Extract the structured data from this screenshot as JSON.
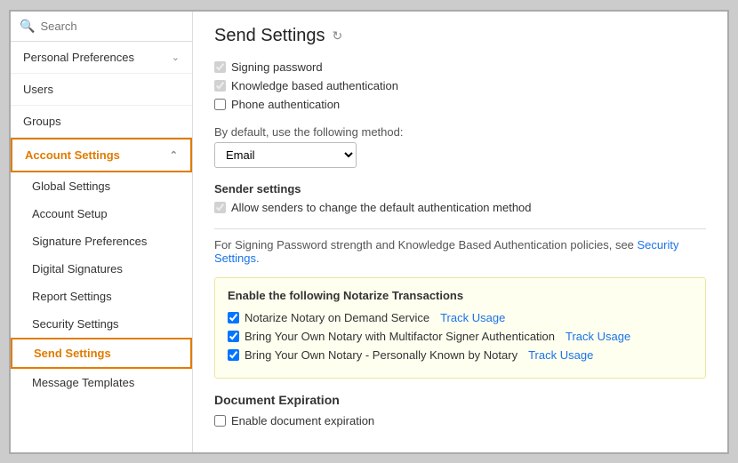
{
  "sidebar": {
    "search_placeholder": "Search",
    "nav_items": [
      {
        "id": "personal-preferences",
        "label": "Personal Preferences",
        "hasChevron": true,
        "expanded": false,
        "active": false
      },
      {
        "id": "users",
        "label": "Users",
        "hasChevron": false,
        "expanded": false,
        "active": false
      },
      {
        "id": "groups",
        "label": "Groups",
        "hasChevron": false,
        "expanded": false,
        "active": false
      },
      {
        "id": "account-settings",
        "label": "Account Settings",
        "hasChevron": true,
        "expanded": true,
        "active": true
      }
    ],
    "sub_items": [
      {
        "id": "global-settings",
        "label": "Global Settings",
        "active": false
      },
      {
        "id": "account-setup",
        "label": "Account Setup",
        "active": false
      },
      {
        "id": "signature-preferences",
        "label": "Signature Preferences",
        "active": false
      },
      {
        "id": "digital-signatures",
        "label": "Digital Signatures",
        "active": false
      },
      {
        "id": "report-settings",
        "label": "Report Settings",
        "active": false
      },
      {
        "id": "security-settings",
        "label": "Security Settings",
        "active": false
      },
      {
        "id": "send-settings",
        "label": "Send Settings",
        "active": true
      },
      {
        "id": "message-templates",
        "label": "Message Templates",
        "active": false
      }
    ]
  },
  "main": {
    "title": "Send Settings",
    "checkboxes": {
      "signing_password": {
        "label": "Signing password",
        "checked": true
      },
      "knowledge_based": {
        "label": "Knowledge based authentication",
        "checked": true
      },
      "phone_auth": {
        "label": "Phone authentication",
        "checked": false
      }
    },
    "default_method_label": "By default, use the following method:",
    "default_method_options": [
      "Email"
    ],
    "default_method_value": "Email",
    "sender_settings_label": "Sender settings",
    "allow_senders_label": "Allow senders to change the default authentication method",
    "security_note": "For Signing Password strength and Knowledge Based Authentication policies, see ",
    "security_link_label": "Security Settings.",
    "notarize_section": {
      "title": "Enable the following Notarize Transactions",
      "items": [
        {
          "label": "Notarize Notary on Demand Service",
          "checked": true,
          "track_label": "Track Usage"
        },
        {
          "label": "Bring Your Own Notary with Multifactor Signer Authentication",
          "checked": true,
          "track_label": "Track Usage"
        },
        {
          "label": "Bring Your Own Notary - Personally Known by Notary",
          "checked": true,
          "track_label": "Track Usage"
        }
      ]
    },
    "doc_expiration": {
      "title": "Document Expiration",
      "enable_label": "Enable document expiration",
      "checked": false
    }
  },
  "icons": {
    "search": "🔍",
    "refresh": "↻",
    "chevron_down": "∧",
    "chevron_up": "∨"
  }
}
